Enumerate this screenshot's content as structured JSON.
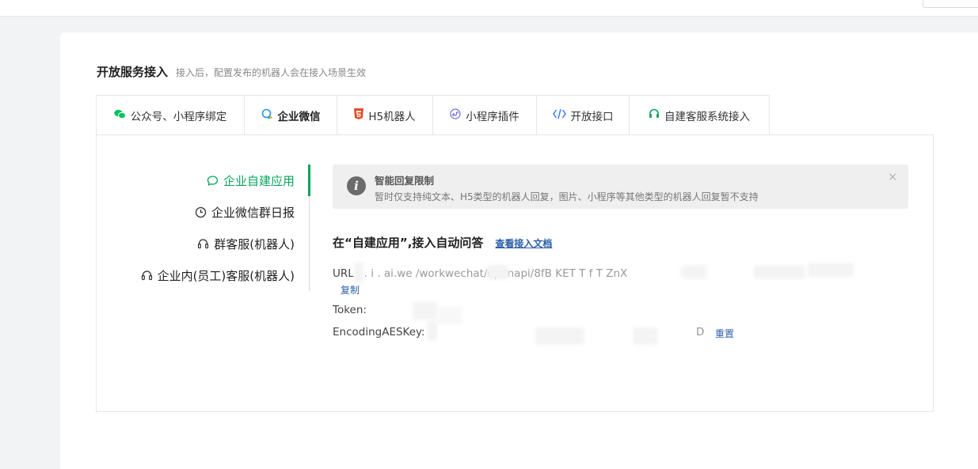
{
  "heading": {
    "title": "开放服务接入",
    "subtitle": "接入后，配置发布的机器人会在接入场景生效"
  },
  "tabs": [
    {
      "label": "公众号、小程序绑定",
      "icon": "wechat-icon"
    },
    {
      "label": "企业微信",
      "icon": "work-wechat-icon"
    },
    {
      "label": "H5机器人",
      "icon": "html5-icon"
    },
    {
      "label": "小程序插件",
      "icon": "mini-program-icon"
    },
    {
      "label": "开放接口",
      "icon": "code-icon"
    },
    {
      "label": "自建客服系统接入",
      "icon": "headset-icon"
    }
  ],
  "active_tab": "企业微信",
  "sidenav": {
    "items": [
      {
        "label": "企业自建应用",
        "icon": "chat-bubble-icon"
      },
      {
        "label": "企业微信群日报",
        "icon": "clock-icon"
      },
      {
        "label": "群客服(机器人)",
        "icon": "headset-icon"
      },
      {
        "label": "企业内(员工)客服(机器人)",
        "icon": "headset-icon"
      }
    ],
    "active": "企业自建应用"
  },
  "alert": {
    "title": "智能回复限制",
    "description": "暂时仅支持纯文本、H5类型的机器人回复，图片、小程序等其他类型的机器人回复暂不支持",
    "close": "×"
  },
  "section": {
    "title": "在“自建应用”,接入自动问答",
    "doc_link": "查看接入文档"
  },
  "fields": {
    "url_label": "URL",
    "url_value": "   .    .  i  .  ai.we          /workwechat/openapi/8fB  KET T f  T  ZnX  ",
    "copy": "复制",
    "token_label": "Token:",
    "aeskey_label": "EncodingAESKey:",
    "aeskey_tail": "D",
    "reset": "重置"
  }
}
